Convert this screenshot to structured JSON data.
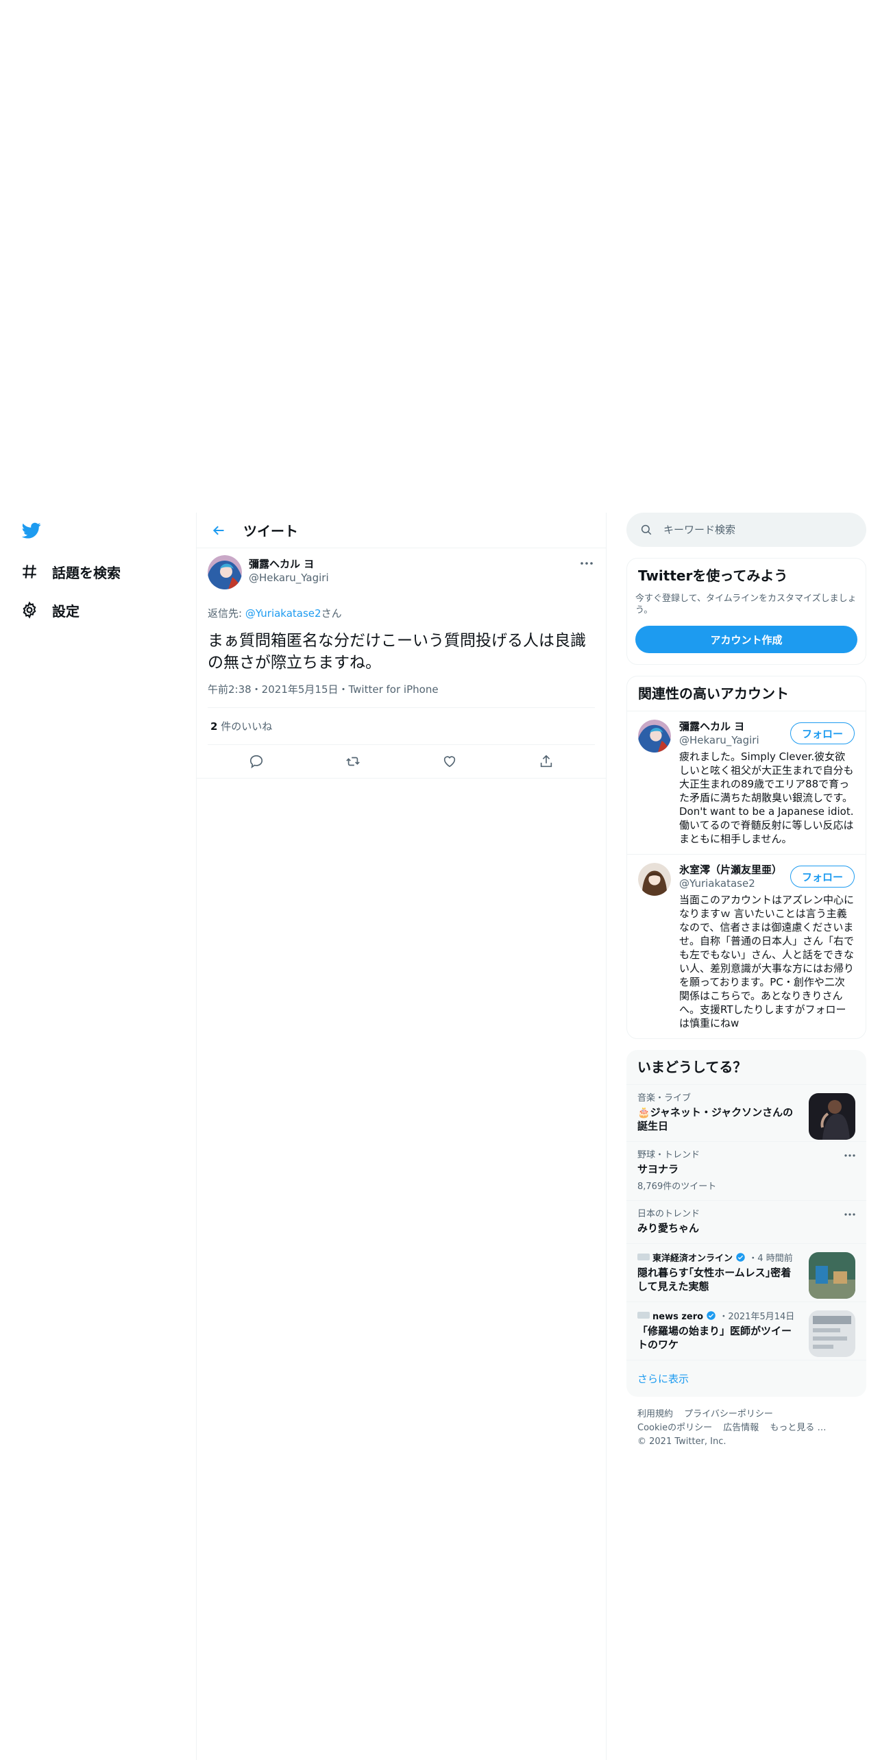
{
  "nav": {
    "logo": "twitter-bird-icon",
    "items": [
      {
        "icon": "hashtag-icon",
        "label": "話題を検索"
      },
      {
        "icon": "gear-icon",
        "label": "設定"
      }
    ]
  },
  "header": {
    "title": "ツイート"
  },
  "tweet": {
    "author_name": "彌露ヘカル ヨ",
    "author_handle": "@Hekaru_Yagiri",
    "reply_prefix": "返信先: ",
    "reply_handle": "@Yuriakatase2",
    "reply_suffix": "さん",
    "text": "まぁ質問箱匿名な分だけこーいう質問投げる人は良識の無さが際立ちますね。",
    "meta": "午前2:38・2021年5月15日・Twitter for iPhone",
    "likes_count": "2",
    "likes_label": " 件のいいね"
  },
  "search": {
    "placeholder": "キーワード検索"
  },
  "signup": {
    "title": "Twitterを使ってみよう",
    "desc": "今すぐ登録して、タイムラインをカスタマイズしましょう。",
    "button": "アカウント作成"
  },
  "related": {
    "title": "関連性の高いアカウント",
    "accounts": [
      {
        "name": "彌露ヘカル ヨ",
        "handle": "@Hekaru_Yagiri",
        "follow": "フォロー",
        "bio": "疲れました。Simply Clever.彼女欲しいと呟く祖父が大正生まれで自分も大正生まれの89歳でエリア88で育った矛盾に満ちた胡散臭い銀流しです。Don't want to be a Japanese idiot.働いてるので脊髄反射に等しい反応はまともに相手しません。"
      },
      {
        "name": "氷室澪（片瀬友里亜）",
        "handle": "@Yuriakatase2",
        "follow": "フォロー",
        "bio": "当面このアカウントはアズレン中心になりますｗ 言いたいことは言う主義なので、信者さまは御遠慮くださいませ。自称「普通の日本人」さん「右でも左でもない」さん、人と話をできない人、差別意識が大事な方にはお帰りを願っております。PC・創作や二次関係はこちらで。あとなりきりさんへ。支援RTしたりしますがフォローは慎重にねw"
      }
    ]
  },
  "trends": {
    "title": "いまどうしてる？",
    "items": [
      {
        "category": "音楽・ライブ",
        "title": "🎂ジャネット・ジャクソンさんの誕生日"
      },
      {
        "category": "野球・トレンド",
        "title": "サヨナラ",
        "count": "8,769件のツイート"
      },
      {
        "category": "日本のトレンド",
        "title": "みり愛ちゃん"
      },
      {
        "source": "東洋経済オンライン",
        "time": "・4 時間前",
        "title": "隠れ暮らす｢女性ホームレス｣密着して見えた実態"
      },
      {
        "source": "news zero",
        "time": "・2021年5月14日",
        "title": "「修羅場の始まり」医師がツイートのワケ"
      }
    ],
    "show_more": "さらに表示"
  },
  "footer": {
    "links": [
      "利用規約",
      "プライバシーポリシー",
      "Cookieのポリシー",
      "広告情報",
      "もっと見る …"
    ],
    "copyright": "© 2021 Twitter, Inc."
  },
  "colors": {
    "accent": "#1d9bf0",
    "text": "#0f1419",
    "secondary": "#536471",
    "border": "#eff3f4"
  }
}
